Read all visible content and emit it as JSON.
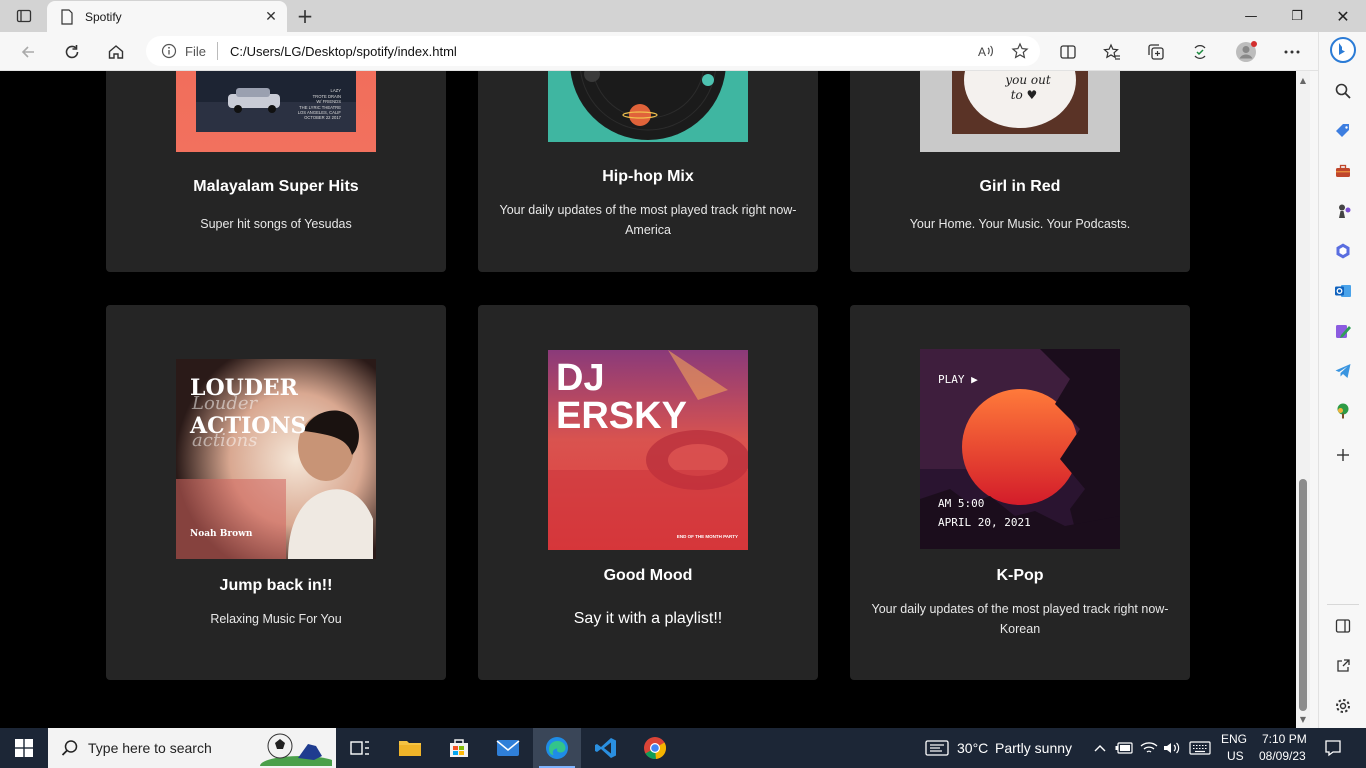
{
  "browser": {
    "tab_title": "Spotify",
    "close_tab_glyph": "✕",
    "new_tab_glyph": "+",
    "address": {
      "scheme_label": "File",
      "url": "C:/Users/LG/Desktop/spotify/index.html"
    },
    "window": {
      "minimize": "—",
      "maximize": "❐",
      "close": "✕"
    }
  },
  "cards": [
    {
      "title": "Malayalam Super Hits",
      "description": "Super hit songs of Yesudas",
      "art": "retro-car-poster",
      "art_text": [
        "LAZY",
        "TROTE DRAIN",
        "W/ FRIENDS",
        "THE LYRIC THEATRE",
        "LOS ANGELES, CALIF",
        "OCTOBER 22 2017"
      ]
    },
    {
      "title": "Hip-hop Mix",
      "description": "Your daily updates of the most played track right now-America",
      "art": "vinyl-space-record"
    },
    {
      "title": "Girl in Red",
      "description": "Your Home. Your Music. Your Podcasts.",
      "art": "heart-note",
      "art_text": [
        "you out",
        "to ♥"
      ]
    },
    {
      "title": "Jump back in!!",
      "description": "Relaxing Music For You",
      "art": "louder-actions-album",
      "art_text": [
        "LOUDER",
        "Louder",
        "ACTIONS",
        "actions",
        "Noah Brown"
      ]
    },
    {
      "title": "Good Mood",
      "description": "Say it with a playlist!!",
      "art": "dj-ersky-poster",
      "art_text": [
        "DJ",
        "ERSKY",
        "END OF THE MONTH PARTY"
      ]
    },
    {
      "title": "K-Pop",
      "description": "Your daily updates of the most played track right now-Korean",
      "art": "vhs-sunset",
      "art_text": [
        "PLAY ▶",
        "AM 5:00",
        "APRIL 20, 2021"
      ]
    }
  ],
  "taskbar": {
    "search_placeholder": "Type here to search",
    "weather": {
      "temp": "30°C",
      "condition": "Partly sunny"
    },
    "language": {
      "lang": "ENG",
      "region": "US"
    },
    "clock": {
      "time": "7:10 PM",
      "date": "08/09/23"
    }
  },
  "colors": {
    "page_bg": "#000000",
    "card_bg": "#252525",
    "taskbar_bg": "#1c2636",
    "browser_chrome": "#f7f7f7"
  }
}
